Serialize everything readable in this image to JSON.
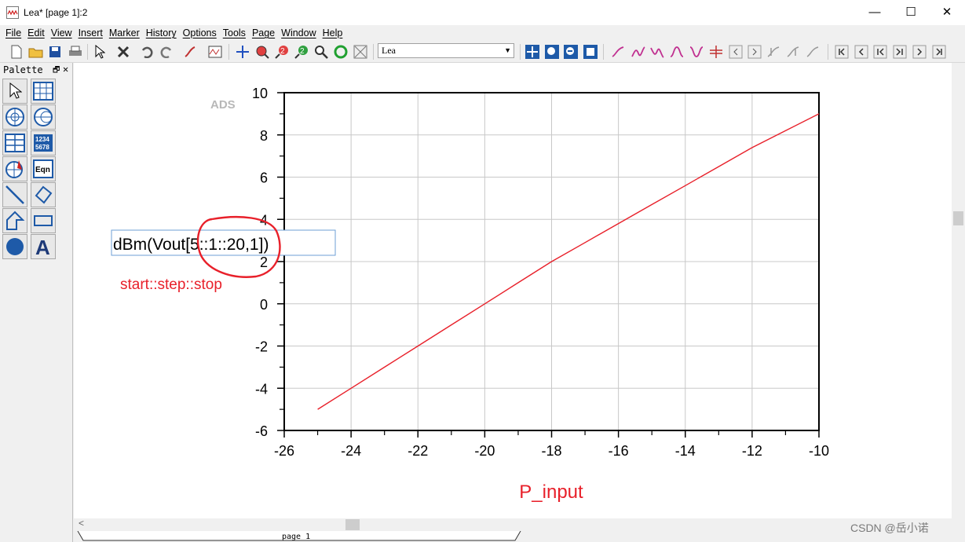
{
  "window": {
    "title": "Lea* [page 1]:2",
    "minimize": "—",
    "maximize": "☐",
    "close": "✕"
  },
  "menu": [
    "File",
    "Edit",
    "View",
    "Insert",
    "Marker",
    "History",
    "Options",
    "Tools",
    "Page",
    "Window",
    "Help"
  ],
  "toolbar": {
    "window_select_value": "Lea"
  },
  "palette": {
    "title": "Palette",
    "pin": "🗗",
    "close": "✕",
    "eqn_label": "Eqn",
    "list_label_1": "1234",
    "list_label_2": "5678"
  },
  "plot": {
    "watermark": "ADS",
    "xlabel": "P_input",
    "legend_expr": "dBm(Vout[5::1::20,1])",
    "annotation": "start::step::stop",
    "colors": {
      "trace": "#e8202a",
      "annotation": "#e8202a",
      "legend_border": "#6c9fd6"
    }
  },
  "chart_data": {
    "type": "line",
    "xlim": [
      -26,
      -10
    ],
    "ylim": [
      -6,
      10
    ],
    "xticks": [
      -26,
      -24,
      -22,
      -20,
      -18,
      -16,
      -14,
      -12,
      -10
    ],
    "yticks": [
      -6,
      -4,
      -2,
      0,
      2,
      4,
      6,
      8,
      10
    ],
    "xlabel": "P_input",
    "grid": true,
    "series": [
      {
        "name": "dBm(Vout[5::1::20,1])",
        "x": [
          -25,
          -24,
          -23,
          -22,
          -21,
          -20,
          -19,
          -18,
          -17,
          -16,
          -15,
          -14,
          -13,
          -12,
          -11,
          -10
        ],
        "y": [
          -5.0,
          -4.0,
          -3.0,
          -2.0,
          -1.0,
          0.0,
          1.0,
          2.0,
          2.9,
          3.8,
          4.7,
          5.6,
          6.5,
          7.4,
          8.2,
          9.0
        ]
      }
    ]
  },
  "tabs": {
    "page_tab": "page 1",
    "scroll_left": "<"
  },
  "footer": {
    "watermark": "CSDN @岳小诺"
  }
}
